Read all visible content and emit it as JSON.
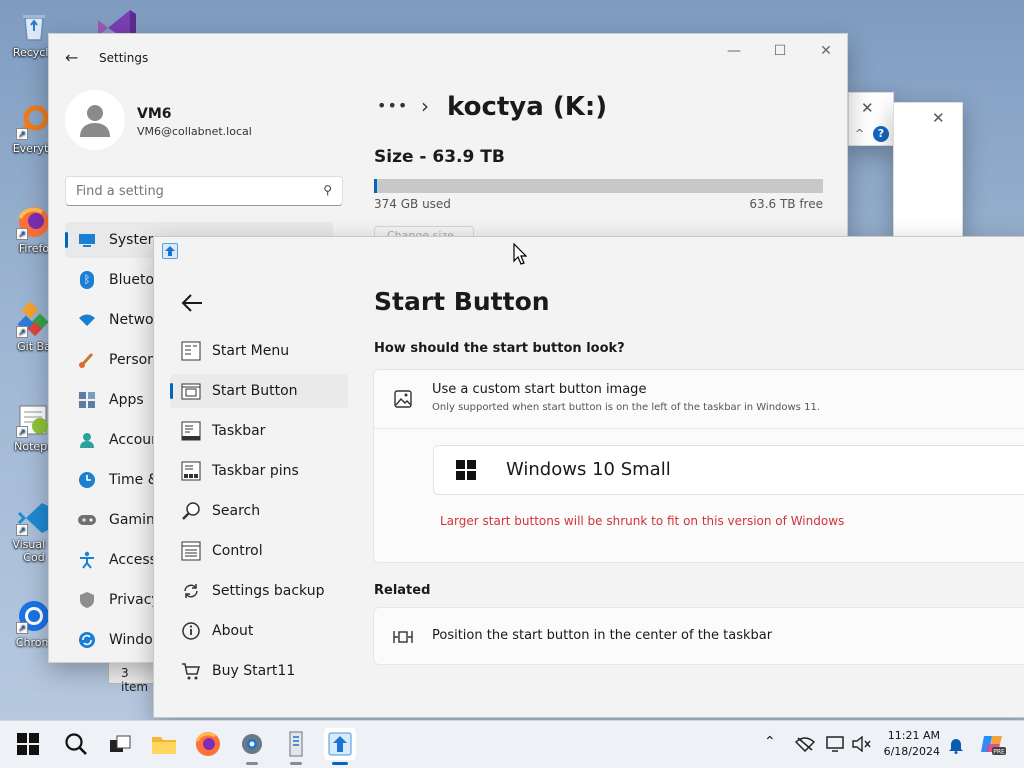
{
  "desktop": {
    "icons": [
      {
        "label": "Recycle",
        "icon": "recycle-bin-icon"
      },
      {
        "label": "Everyth",
        "icon": "everything-search-icon"
      },
      {
        "label": "Firefo",
        "icon": "firefox-icon"
      },
      {
        "label": "Git Ba",
        "icon": "git-bash-icon"
      },
      {
        "label": "Notepa",
        "icon": "notepad-plus-icon"
      },
      {
        "label": "Visual S Cod",
        "icon": "vscode-icon"
      },
      {
        "label": "Chrom",
        "icon": "chrome-icon"
      }
    ]
  },
  "explorer_status": "3 item",
  "settings": {
    "title": "Settings",
    "user": {
      "name": "VM6",
      "email": "VM6@collabnet.local"
    },
    "search_placeholder": "Find a setting",
    "nav": [
      {
        "label": "System"
      },
      {
        "label": "Bluetoo"
      },
      {
        "label": "Networ"
      },
      {
        "label": "Persona"
      },
      {
        "label": "Apps"
      },
      {
        "label": "Accoun"
      },
      {
        "label": "Time &"
      },
      {
        "label": "Gaming"
      },
      {
        "label": "Accessi"
      },
      {
        "label": "Privacy"
      },
      {
        "label": "Window"
      }
    ],
    "breadcrumb_more": "•••",
    "breadcrumb_sep": "›",
    "drive_title": "koctya (K:)",
    "size_label": "Size - 63.9 TB",
    "usage_fraction": 0.006,
    "used_text": "374 GB used",
    "free_text": "63.6 TB free",
    "change_size": "Change size"
  },
  "start11": {
    "page_title": "Start Button",
    "nav": [
      {
        "label": "Start Menu"
      },
      {
        "label": "Start Button"
      },
      {
        "label": "Taskbar"
      },
      {
        "label": "Taskbar pins"
      },
      {
        "label": "Search"
      },
      {
        "label": "Control"
      },
      {
        "label": "Settings backup"
      },
      {
        "label": "About"
      },
      {
        "label": "Buy Start11"
      }
    ],
    "question": "How should the start button look?",
    "custom_title": "Use a custom start button image",
    "custom_sub": "Only supported when start button is on the left of the taskbar in Windows 11.",
    "style_value": "Windows 10 Small",
    "warning": "Larger start buttons will be shrunk to fit on this version of Windows",
    "related_heading": "Related",
    "related_item": "Position the start button in the center of the taskbar"
  },
  "taskbar": {
    "time": "11:21 AM",
    "date": "6/18/2024"
  },
  "colors": {
    "accent": "#0067c0",
    "warning": "#d13438"
  }
}
